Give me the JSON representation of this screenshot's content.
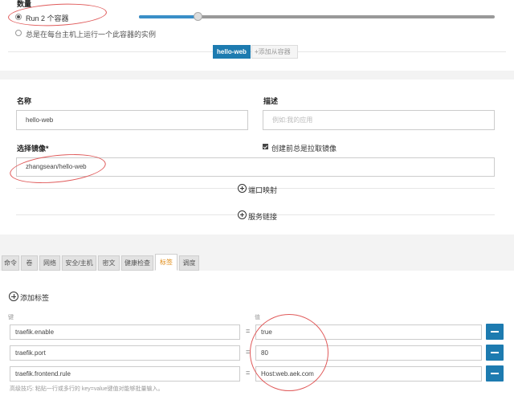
{
  "scale": {
    "label": "数量",
    "run_option": "Run 2 个容器",
    "global_option": "总是在每台主机上运行一个此容器的实例",
    "slider_fraction": 0.165
  },
  "service_tabs": {
    "primary": "hello-web",
    "add_sidekick": "添加从容器"
  },
  "container": {
    "name_label": "名称",
    "name_value": "hello-web",
    "desc_label": "描述",
    "desc_placeholder": "例如:我的应用",
    "image_label": "选择镜像*",
    "image_value": "zhangsean/hello-web",
    "pull_label": "创建前总是拉取镜像",
    "port_map": "端口映射",
    "service_link": "服务链接"
  },
  "tabs": [
    "命令",
    "卷",
    "网络",
    "安全/主机",
    "密文",
    "健康检查",
    "标签",
    "调度"
  ],
  "active_tab": "标签",
  "labels": {
    "add_label": "添加标签",
    "key_header": "键",
    "value_header": "值",
    "rows": [
      {
        "key": "traefik.enable",
        "value": "true"
      },
      {
        "key": "traefik.port",
        "value": "80"
      },
      {
        "key": "traefik.frontend.rule",
        "value": "Host:web.aek.com"
      }
    ],
    "tip": "高级技巧: 粘贴一行或多行的 key=value键值对能够批量输入。"
  },
  "colors": {
    "accent": "#1d7bb0",
    "active_tab": "#e08a12",
    "annotation": "#e05a5a"
  }
}
